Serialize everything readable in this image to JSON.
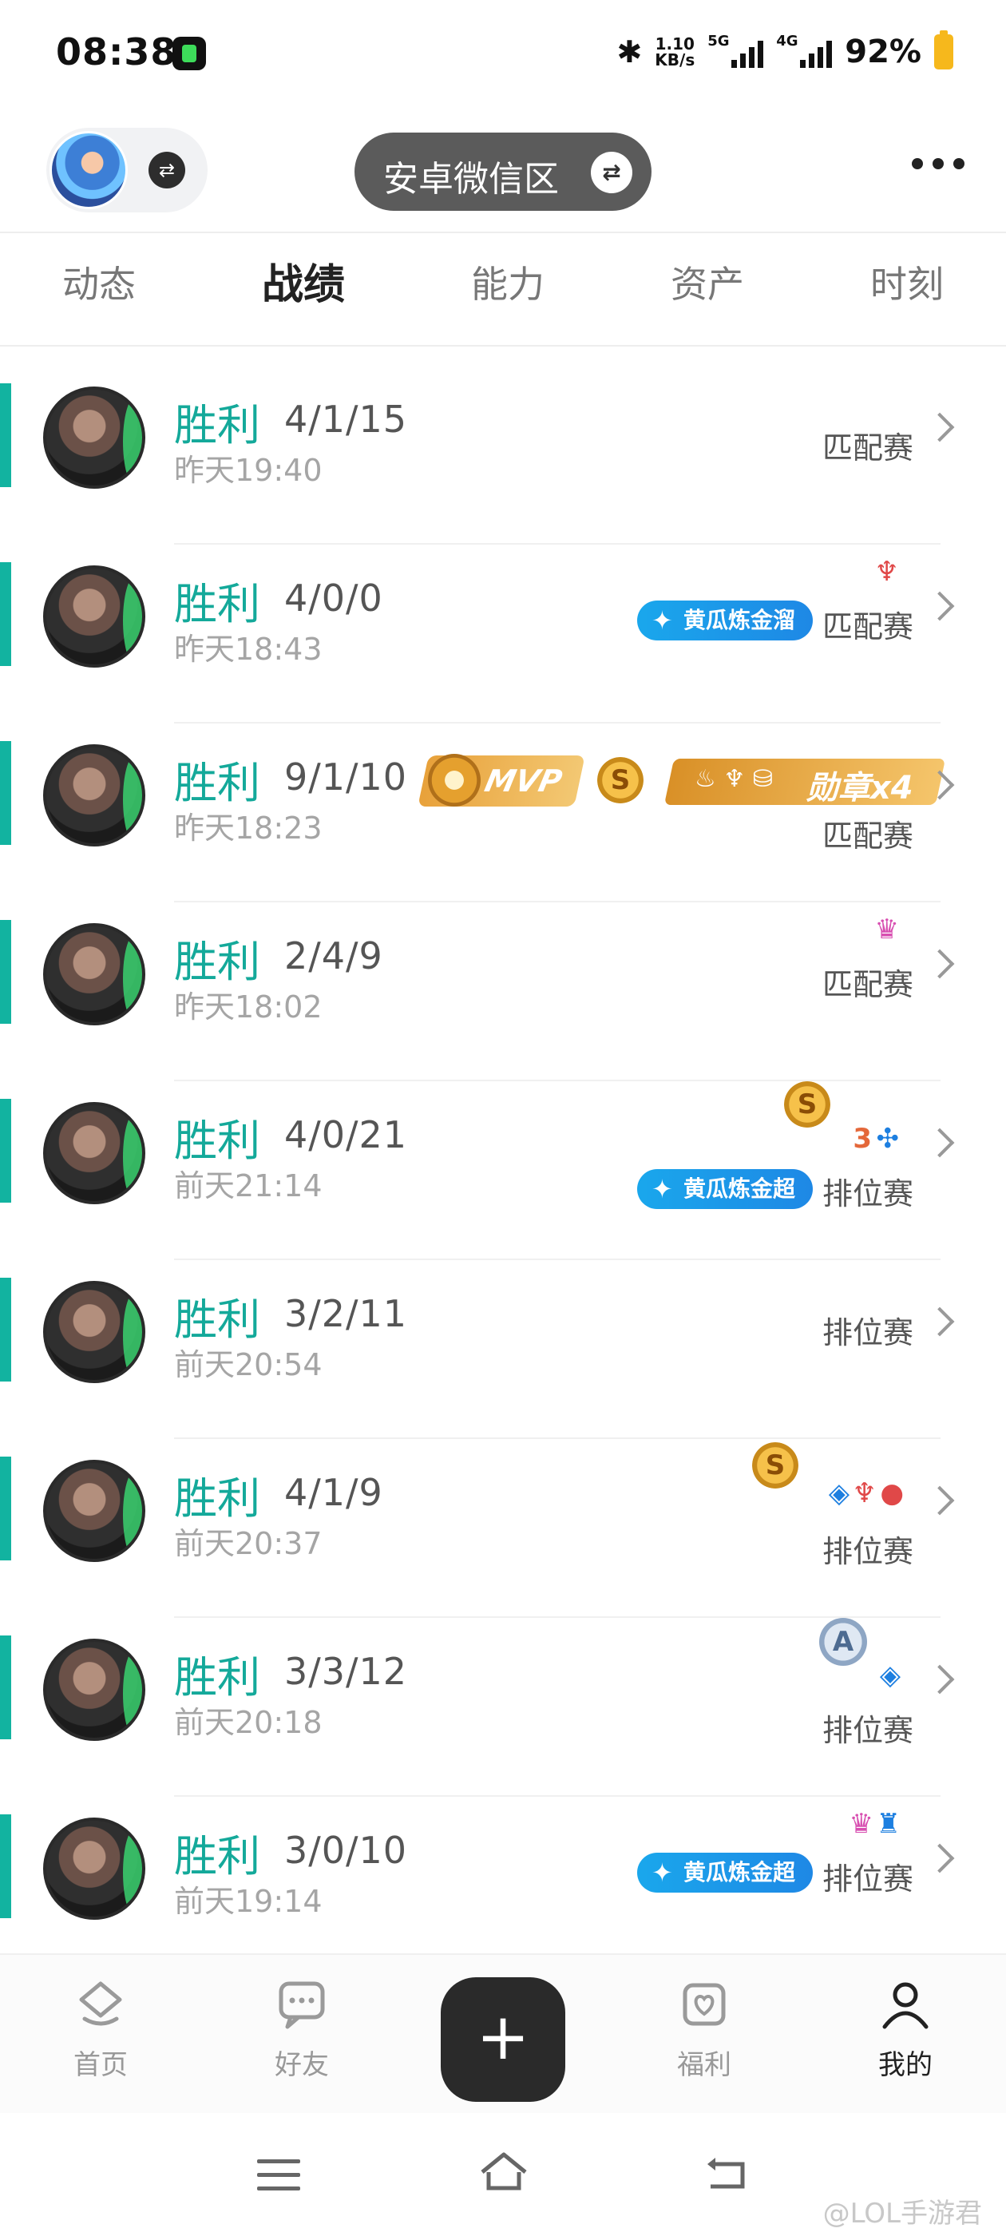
{
  "status_bar": {
    "time": "08:38",
    "speed_value": "1.10",
    "speed_unit": "KB/s",
    "net1": "5G",
    "net2": "4G",
    "battery": "92%"
  },
  "header": {
    "region_label": "安卓微信区"
  },
  "tabs": [
    {
      "label": "动态"
    },
    {
      "label": "战绩"
    },
    {
      "label": "能力"
    },
    {
      "label": "资产"
    },
    {
      "label": "时刻"
    }
  ],
  "matches": [
    {
      "result": "胜利",
      "kda": "4/1/15",
      "time": "昨天19:40",
      "mode": "匹配赛"
    },
    {
      "result": "胜利",
      "kda": "4/0/0",
      "time": "昨天18:43",
      "mode": "匹配赛",
      "tag": "黄瓜炼金溜"
    },
    {
      "result": "胜利",
      "kda": "9/1/10",
      "time": "昨天18:23",
      "mode": "匹配赛",
      "mvp": "MVP",
      "medal": "勋章x4",
      "coin": "S"
    },
    {
      "result": "胜利",
      "kda": "2/4/9",
      "time": "昨天18:02",
      "mode": "匹配赛"
    },
    {
      "result": "胜利",
      "kda": "4/0/21",
      "time": "前天21:14",
      "mode": "排位赛",
      "tag": "黄瓜炼金超",
      "coin": "S",
      "badge_num": "3"
    },
    {
      "result": "胜利",
      "kda": "3/2/11",
      "time": "前天20:54",
      "mode": "排位赛"
    },
    {
      "result": "胜利",
      "kda": "4/1/9",
      "time": "前天20:37",
      "mode": "排位赛",
      "coin": "S"
    },
    {
      "result": "胜利",
      "kda": "3/3/12",
      "time": "前天20:18",
      "mode": "排位赛",
      "coin": "A"
    },
    {
      "result": "胜利",
      "kda": "3/0/10",
      "time": "前天19:14",
      "mode": "排位赛",
      "tag": "黄瓜炼金超"
    }
  ],
  "bottom_nav": [
    {
      "label": "首页",
      "icon": "home-icon"
    },
    {
      "label": "好友",
      "icon": "chat-icon"
    },
    {
      "label": "+",
      "icon": "plus-icon"
    },
    {
      "label": "福利",
      "icon": "gift-heart-icon"
    },
    {
      "label": "我的",
      "icon": "person-icon"
    }
  ],
  "watermark": "@LOL手游君",
  "colors": {
    "accent": "#12b3a0",
    "win_text": "#14a99a",
    "tag_blue": "#1aa7ec",
    "gold": "#e8a13a"
  }
}
